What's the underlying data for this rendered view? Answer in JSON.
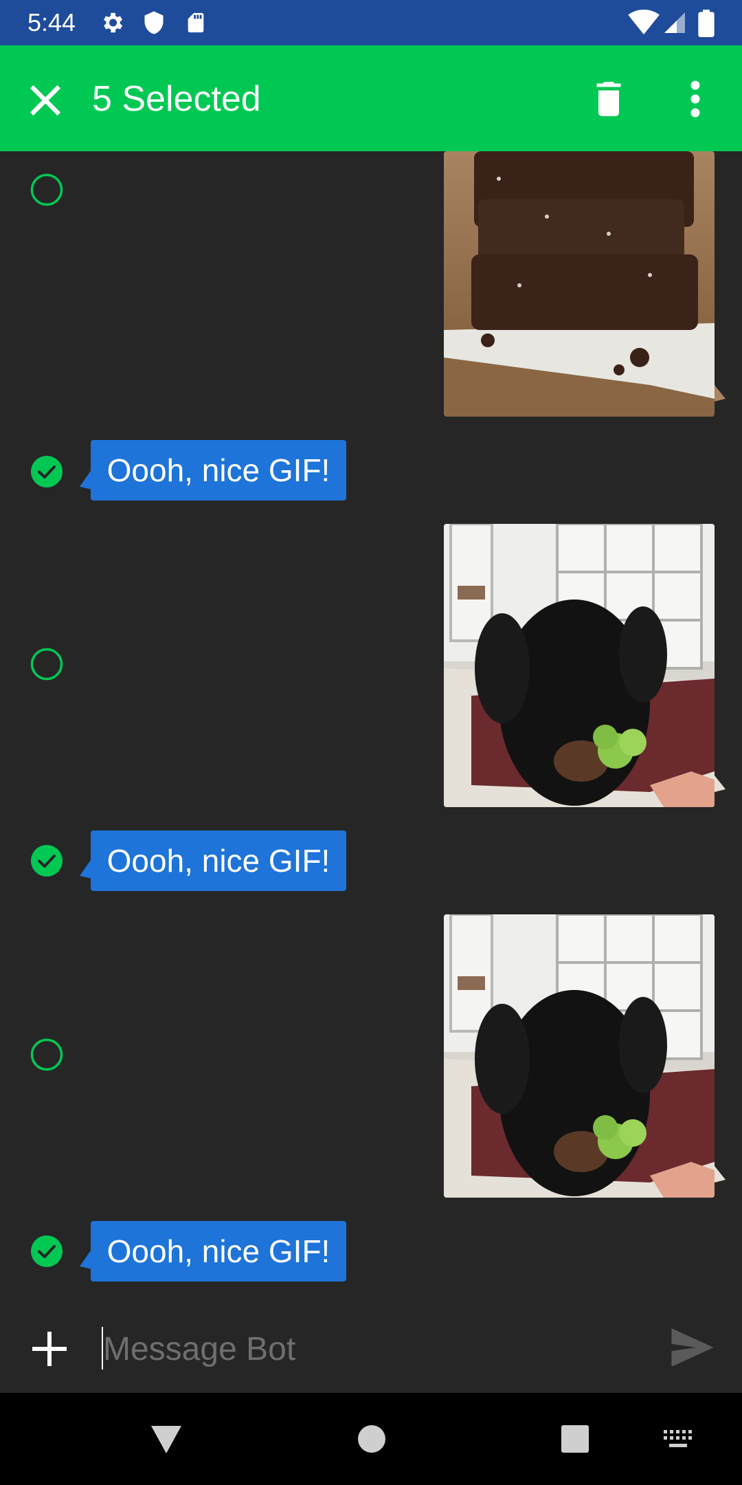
{
  "status_bar": {
    "time": "5:44",
    "icons": [
      "gear-icon",
      "shield-icon",
      "sd-card-icon",
      "wifi-icon",
      "signal-icon",
      "battery-icon"
    ],
    "background": "#1e4c9b"
  },
  "action_bar": {
    "title": "5 Selected",
    "background": "#00c853",
    "icons": [
      "close-icon",
      "trash-icon",
      "more-vert-icon"
    ]
  },
  "messages": [
    {
      "type": "image",
      "content": "stacked brownies on white paper",
      "selected": false
    },
    {
      "type": "text",
      "text": "Oooh, nice GIF!",
      "selected": true
    },
    {
      "type": "image",
      "content": "black puppy sniffing broccoli",
      "selected": false
    },
    {
      "type": "text",
      "text": "Oooh, nice GIF!",
      "selected": true
    },
    {
      "type": "image",
      "content": "black puppy sniffing broccoli",
      "selected": false
    },
    {
      "type": "text",
      "text": "Oooh, nice GIF!",
      "selected": true
    }
  ],
  "colors": {
    "accent": "#00c853",
    "bubble": "#1e74d8",
    "background": "#262626"
  },
  "composer": {
    "placeholder": "Message Bot",
    "icons": [
      "plus-icon",
      "send-icon"
    ]
  },
  "nav_bar": {
    "icons": [
      "back-triangle-icon",
      "home-circle-icon",
      "recents-square-icon",
      "keyboard-icon"
    ]
  }
}
